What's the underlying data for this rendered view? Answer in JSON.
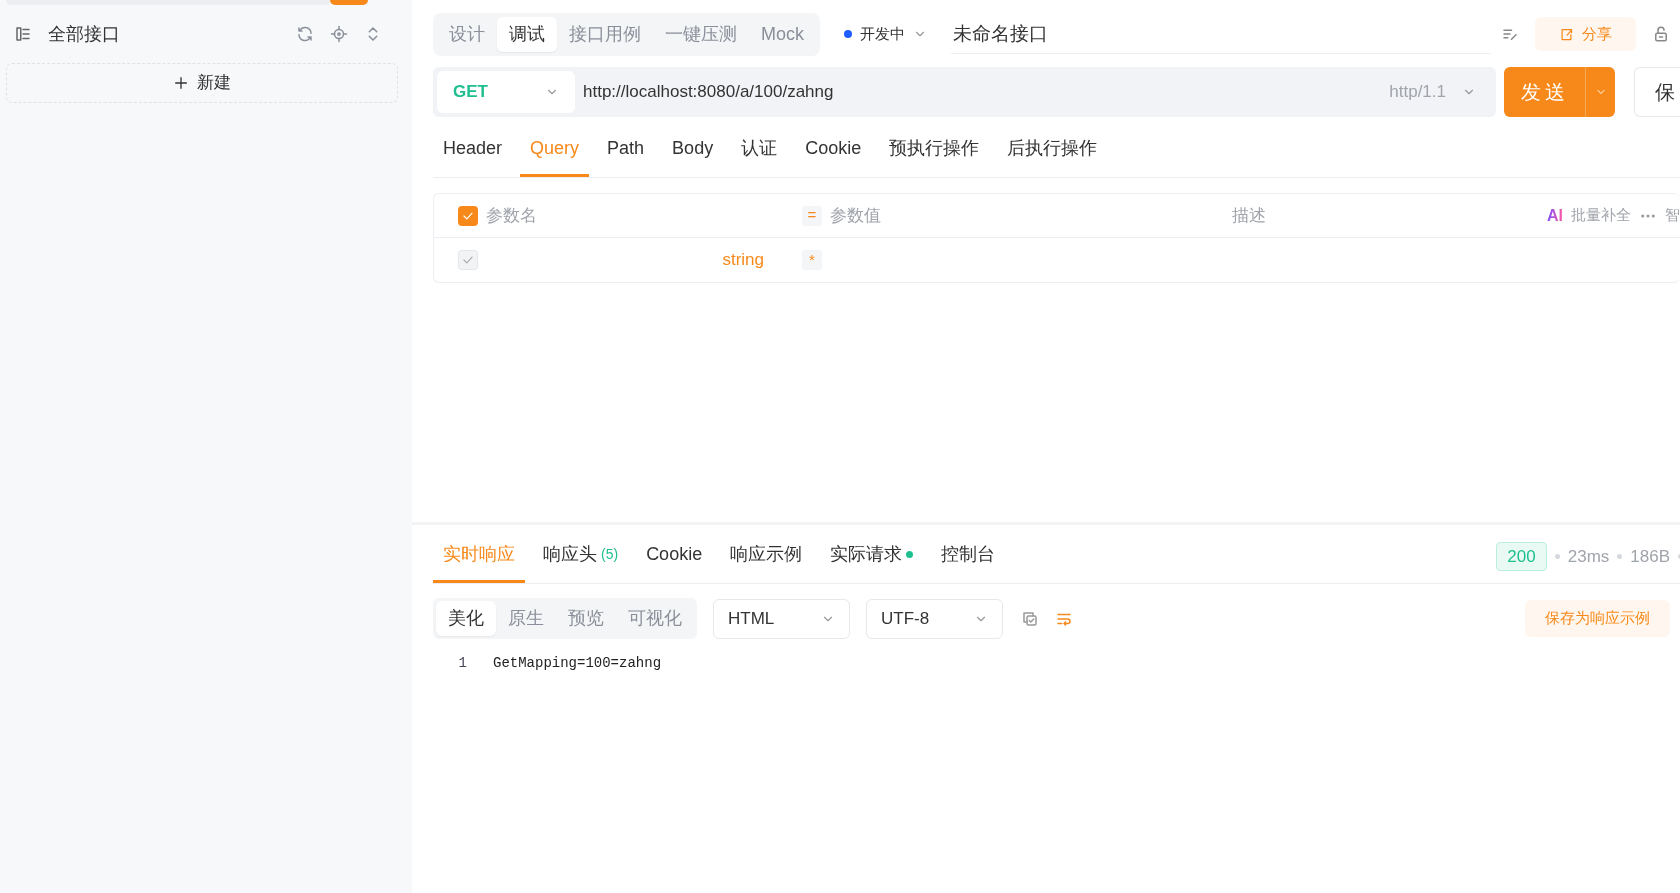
{
  "sidebar": {
    "title": "全部接口",
    "new_button": "新建"
  },
  "mode_tabs": [
    {
      "label": "设计",
      "selected": false
    },
    {
      "label": "调试",
      "selected": true
    },
    {
      "label": "接口用例",
      "selected": false
    },
    {
      "label": "一键压测",
      "selected": false
    },
    {
      "label": "Mock",
      "selected": false
    }
  ],
  "environment": {
    "label": "开发中"
  },
  "request_name": {
    "value": "未命名接口"
  },
  "share_button": "分享",
  "request": {
    "method": "GET",
    "url": "http://localhost:8080/a/100/zahng",
    "protocol": "http/1.1",
    "send_button": "发送",
    "save_button": "保"
  },
  "request_tabs": [
    {
      "label": "Header",
      "selected": false
    },
    {
      "label": "Query",
      "selected": true
    },
    {
      "label": "Path",
      "selected": false
    },
    {
      "label": "Body",
      "selected": false
    },
    {
      "label": "认证",
      "selected": false
    },
    {
      "label": "Cookie",
      "selected": false
    },
    {
      "label": "预执行操作",
      "selected": false
    },
    {
      "label": "后执行操作",
      "selected": false
    }
  ],
  "params": {
    "all_checked": true,
    "columns": [
      "参数名",
      "参数值",
      "描述"
    ],
    "operator": "=",
    "ai_label": "AI",
    "bulk_fill": "批量补全",
    "more": "智",
    "rows": [
      {
        "checked": true,
        "disabled": true,
        "type": "string",
        "required": "*"
      }
    ]
  },
  "response": {
    "tabs": [
      {
        "label": "实时响应",
        "selected": true
      },
      {
        "label": "响应头",
        "count": "(5)",
        "selected": false
      },
      {
        "label": "Cookie",
        "selected": false
      },
      {
        "label": "响应示例",
        "selected": false
      },
      {
        "label": "实际请求",
        "indicator": true,
        "selected": false
      },
      {
        "label": "控制台",
        "selected": false
      }
    ],
    "status": "200",
    "time": "23ms",
    "size": "186B",
    "view_modes": [
      {
        "label": "美化",
        "selected": true
      },
      {
        "label": "原生",
        "selected": false
      },
      {
        "label": "预览",
        "selected": false
      },
      {
        "label": "可视化",
        "selected": false
      }
    ],
    "format": "HTML",
    "encoding": "UTF-8",
    "wrap_on": true,
    "save_example": "保存为响应示例",
    "lines": [
      {
        "number": "1",
        "text": "GetMapping=100=zahng"
      }
    ]
  }
}
